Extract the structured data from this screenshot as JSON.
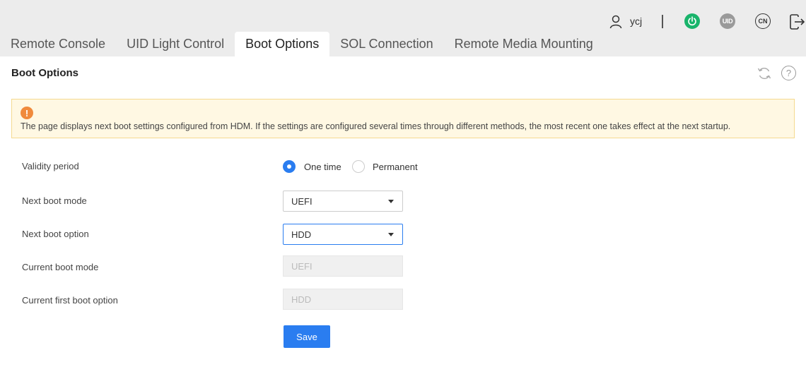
{
  "user": {
    "name": "ycj"
  },
  "top_buttons": {
    "uid": "UID",
    "language": "CN"
  },
  "tabs": [
    {
      "label": "Remote Console"
    },
    {
      "label": "UID Light Control"
    },
    {
      "label": "Boot Options"
    },
    {
      "label": "SOL Connection"
    },
    {
      "label": "Remote Media Mounting"
    }
  ],
  "active_tab": "Boot Options",
  "panel": {
    "title": "Boot Options",
    "notice": "The page displays next boot settings configured from HDM. If the settings are configured several times through different methods, the most recent one takes effect at the next startup."
  },
  "form": {
    "validity_period": {
      "label": "Validity period",
      "options": [
        "One time",
        "Permanent"
      ],
      "selected": "One time"
    },
    "next_boot_mode": {
      "label": "Next boot mode",
      "value": "UEFI"
    },
    "next_boot_option": {
      "label": "Next boot option",
      "value": "HDD"
    },
    "current_boot_mode": {
      "label": "Current boot mode",
      "value": "UEFI"
    },
    "current_first_boot_option": {
      "label": "Current first boot option",
      "value": "HDD"
    },
    "save_label": "Save"
  },
  "colors": {
    "accent": "#2a7df0",
    "power": "#19b46b",
    "notice_bg": "#fff8e3",
    "warning": "#f08a3c"
  },
  "icons": [
    "user-icon",
    "power-icon",
    "uid-icon",
    "language-icon",
    "logout-icon",
    "refresh-icon",
    "help-icon",
    "warning-icon",
    "chevron-down-icon"
  ]
}
